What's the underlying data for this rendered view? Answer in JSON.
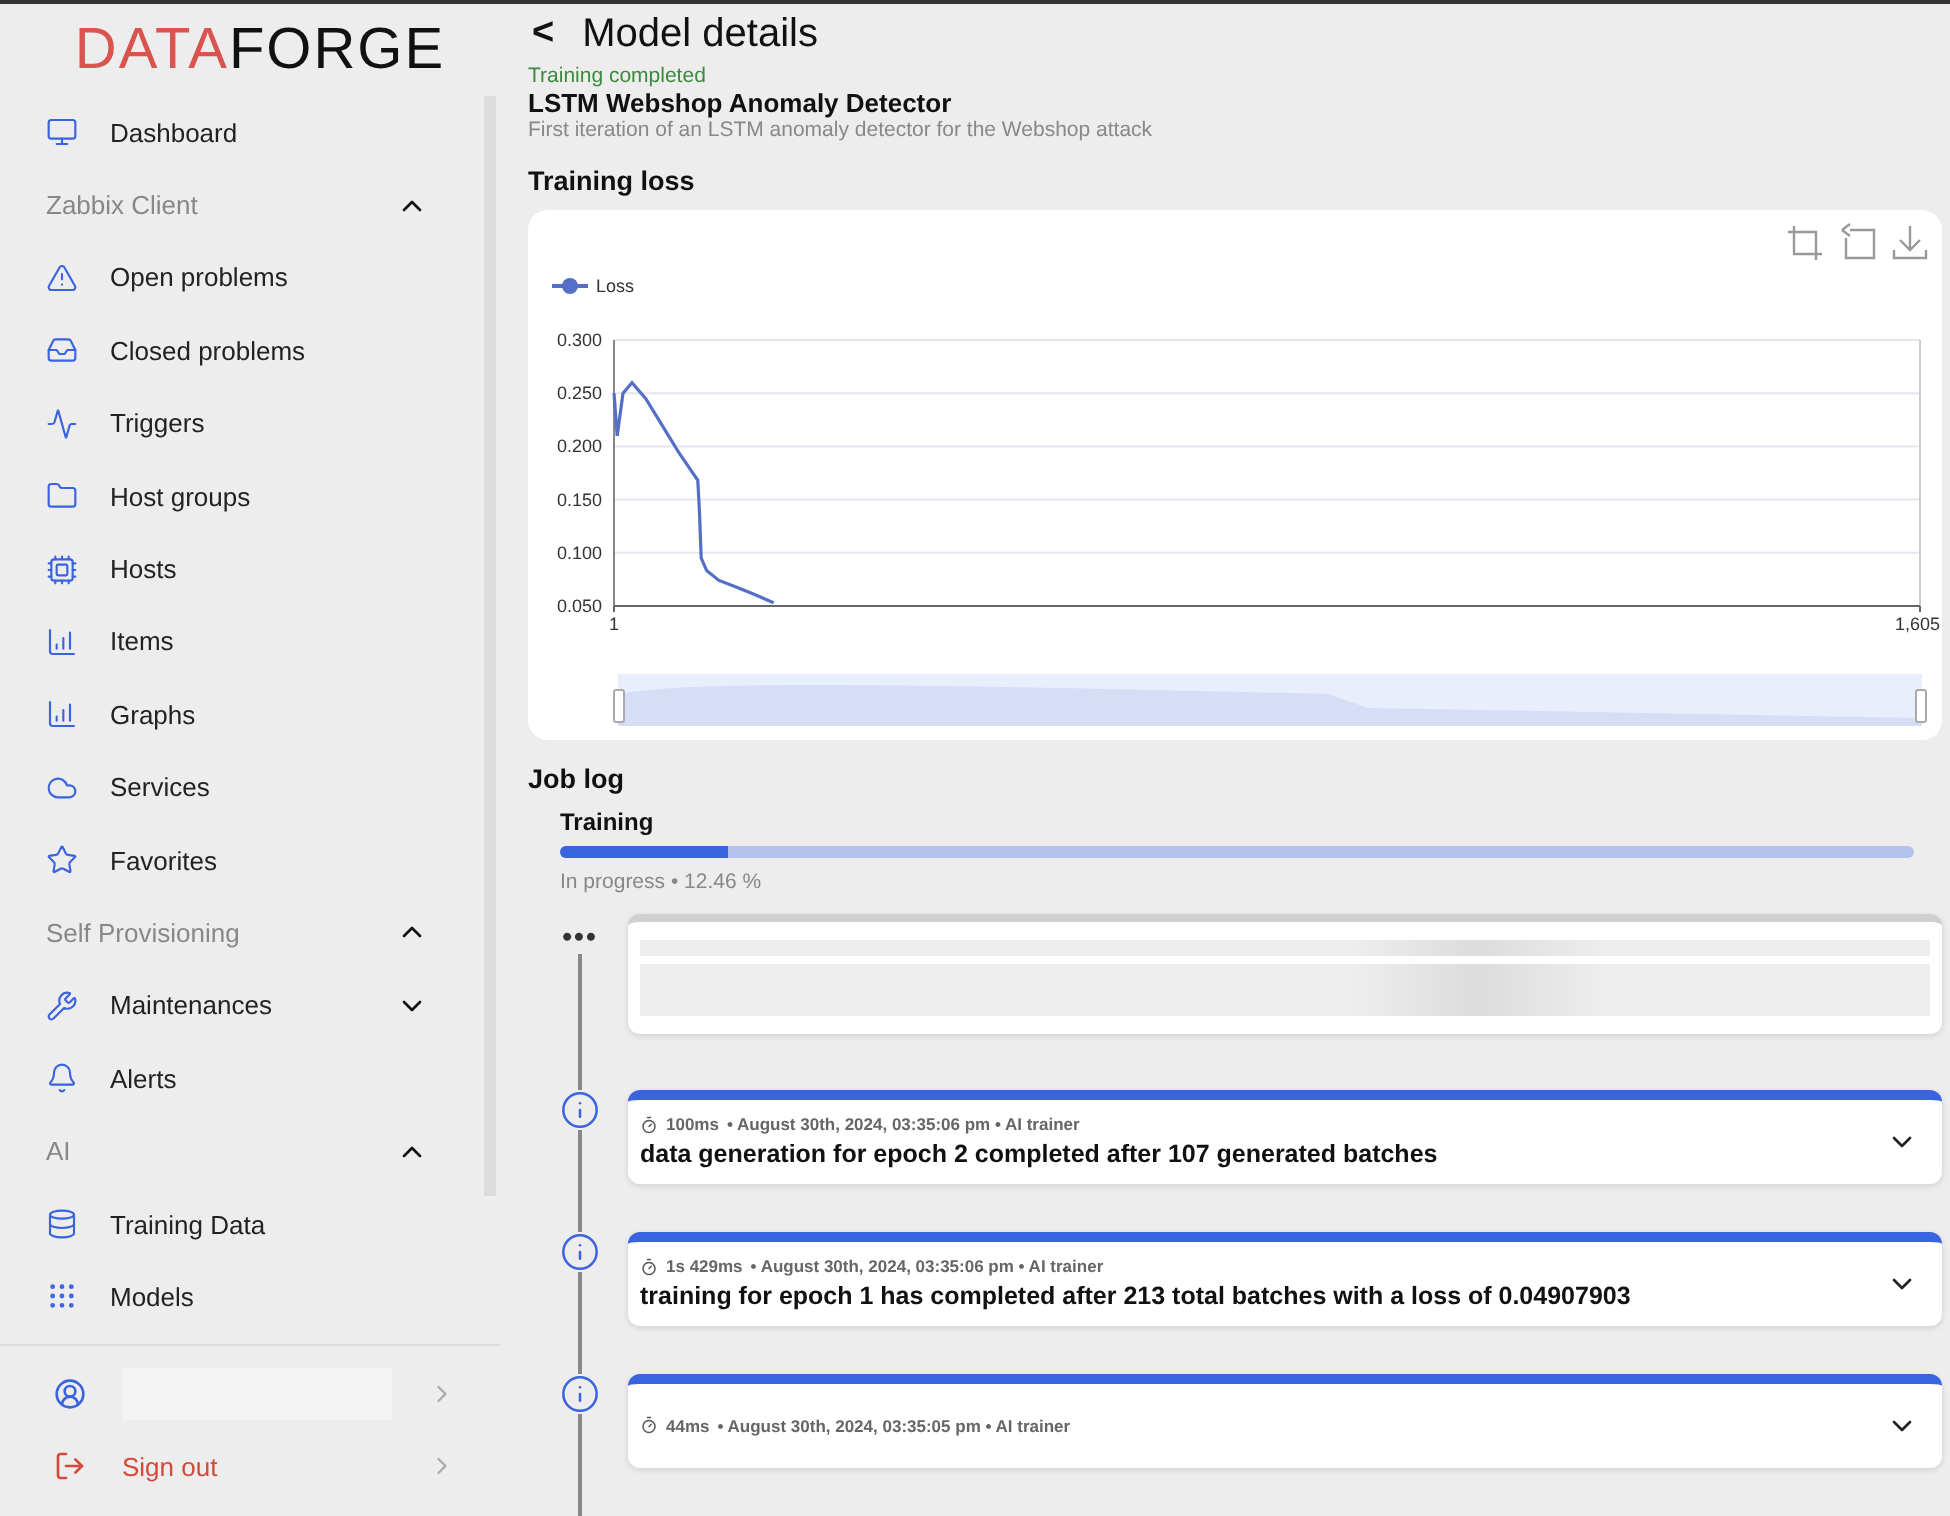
{
  "logo": {
    "part_1": "DATA",
    "part_2": "FORGE"
  },
  "sidebar": {
    "items": [
      {
        "kind": "item",
        "label": "Dashboard"
      },
      {
        "kind": "section",
        "label": "Zabbix Client",
        "expanded": true
      },
      {
        "kind": "item",
        "label": "Open problems"
      },
      {
        "kind": "item",
        "label": "Closed problems"
      },
      {
        "kind": "item",
        "label": "Triggers"
      },
      {
        "kind": "item",
        "label": "Host groups"
      },
      {
        "kind": "item",
        "label": "Hosts"
      },
      {
        "kind": "item",
        "label": "Items"
      },
      {
        "kind": "item",
        "label": "Graphs"
      },
      {
        "kind": "item",
        "label": "Services"
      },
      {
        "kind": "item",
        "label": "Favorites"
      },
      {
        "kind": "section",
        "label": "Self Provisioning",
        "expanded": true
      },
      {
        "kind": "group",
        "label": "Maintenances",
        "expanded": false
      },
      {
        "kind": "item",
        "label": "Alerts"
      },
      {
        "kind": "section",
        "label": "AI",
        "expanded": true
      },
      {
        "kind": "item",
        "label": "Training Data"
      },
      {
        "kind": "item",
        "label": "Models"
      }
    ],
    "footer": {
      "sign_out": "Sign out"
    }
  },
  "header": {
    "back": "<",
    "title": "Model details"
  },
  "model": {
    "status": "Training completed",
    "name": "LSTM Webshop Anomaly Detector",
    "description": "First iteration of an LSTM anomaly detector for the Webshop attack"
  },
  "loss_section": {
    "title": "Training loss",
    "chart_data": {
      "type": "line",
      "x": [
        1,
        5,
        12,
        23,
        40,
        60,
        80,
        104,
        106,
        108,
        115,
        130,
        150,
        170,
        197
      ],
      "series": [
        {
          "name": "Loss",
          "color": "#5470c6",
          "values": [
            0.25,
            0.21,
            0.25,
            0.26,
            0.245,
            0.22,
            0.195,
            0.168,
            0.14,
            0.095,
            0.083,
            0.074,
            0.068,
            0.062,
            0.053
          ]
        }
      ],
      "grid": true,
      "xlim": [
        1,
        1605
      ],
      "ylim": [
        0.05,
        0.3
      ],
      "xticks": [
        1,
        {
          "value": 1605,
          "label": "1,605"
        }
      ],
      "yticks": [
        {
          "value": 0.05,
          "label": "0.050"
        },
        {
          "value": 0.1,
          "label": "0.100"
        },
        {
          "value": 0.15,
          "label": "0.150"
        },
        {
          "value": 0.2,
          "label": "0.200"
        },
        {
          "value": 0.25,
          "label": "0.250"
        },
        {
          "value": 0.3,
          "label": "0.300"
        }
      ]
    }
  },
  "job_log": {
    "title": "Job log",
    "stage": "Training",
    "level": 0.1246,
    "progress_text": "In progress • 12.46 %",
    "entries": [
      {
        "kind": "loading",
        "marker": "•••"
      },
      {
        "kind": "event",
        "duration": "100ms",
        "meta": "• August 30th, 2024, 03:35:06 pm • AI trainer",
        "message": "data generation for epoch 2 completed after 107 generated batches"
      },
      {
        "kind": "event",
        "duration": "1s 429ms",
        "meta": "• August 30th, 2024, 03:35:06 pm • AI trainer",
        "message": "training for epoch 1 has completed after 213 total batches with a loss of 0.04907903"
      },
      {
        "kind": "event",
        "duration": "44ms",
        "meta": "• August 30th, 2024, 03:35:05 pm • AI trainer"
      }
    ]
  }
}
